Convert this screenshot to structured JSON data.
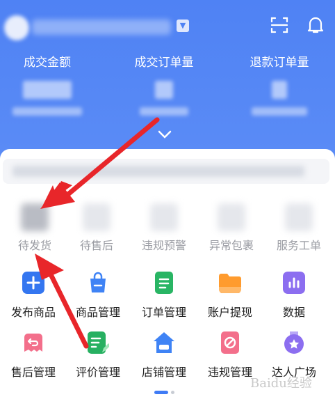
{
  "header": {
    "bg_color": "#4f82f4",
    "icons": [
      "scan-icon",
      "bell-icon",
      "chevron-down-icon"
    ],
    "stats": [
      {
        "label": "成交金额"
      },
      {
        "label": "成交订单量"
      },
      {
        "label": "退款订单量"
      }
    ]
  },
  "order_status": [
    {
      "label": "待发货"
    },
    {
      "label": "待售后"
    },
    {
      "label": "违规预警"
    },
    {
      "label": "异常包裹"
    },
    {
      "label": "服务工单"
    }
  ],
  "tools_row1": [
    {
      "label": "发布商品",
      "icon": "plus-icon",
      "color": "#3476f0"
    },
    {
      "label": "商品管理",
      "icon": "shopping-bag-icon",
      "color": "#3f83f5"
    },
    {
      "label": "订单管理",
      "icon": "clipboard-icon",
      "color": "#29b564"
    },
    {
      "label": "账户提现",
      "icon": "folder-icon",
      "color": "#ff9b2e"
    },
    {
      "label": "数据",
      "icon": "bar-chart-icon",
      "color": "#8c6ef0"
    }
  ],
  "tools_row2": [
    {
      "label": "售后管理",
      "icon": "return-icon",
      "color": "#f36f8b"
    },
    {
      "label": "评价管理",
      "icon": "review-edit-icon",
      "color": "#27b061"
    },
    {
      "label": "店铺管理",
      "icon": "store-home-icon",
      "color": "#3f83f5"
    },
    {
      "label": "违规管理",
      "icon": "forbidden-icon",
      "color": "#f36f8b"
    },
    {
      "label": "达人广场",
      "icon": "star-badge-icon",
      "color": "#8c6ef0"
    }
  ],
  "annotation_color": "#e8262a",
  "watermark": "Baidu经验"
}
